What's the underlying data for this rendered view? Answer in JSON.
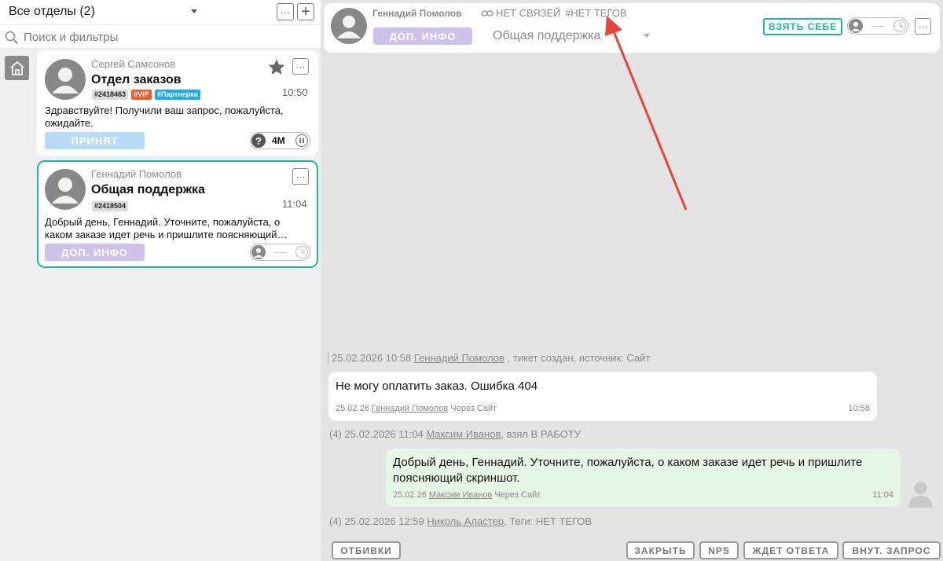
{
  "sidebar": {
    "department_selector": "Все отделы (2)",
    "more_label": "···",
    "add_label": "+",
    "search_placeholder": "Поиск и фильтры"
  },
  "tickets": [
    {
      "client_name": "Сергей Самсонов",
      "department": "Отдел заказов",
      "time": "10:50",
      "tags": [
        "#2418463",
        "#VIP",
        "#Партнерка"
      ],
      "message": "Здравствуйте! Получили ваш запрос, пожалуйста, ожидайте.",
      "status": "ПРИНЯТ",
      "timer": "4М",
      "timer_prefix": "?",
      "more_label": "···",
      "starred": true
    },
    {
      "client_name": "Геннадий Помолов",
      "department": "Общая поддержка",
      "time": "11:04",
      "tags": [
        "#2418504"
      ],
      "message": "Добрый день, Геннадий. Уточните, пожалуйста, о каком заказе идет речь и пришлите поясняющий…",
      "status": "ДОП. ИНФО",
      "more_label": "···",
      "selected": true
    }
  ],
  "header": {
    "client_name": "Геннадий Помолов",
    "links": "НЕТ СВЯЗЕЙ",
    "tags": "#НЕТ ТЕГОВ",
    "info_button": "ДОП. ИНФО",
    "department": "Общая поддержка",
    "take_button": "ВЗЯТЬ СЕБЕ",
    "more_label": "···"
  },
  "feed": {
    "event1": {
      "datetime": "25.02.2026 10:58",
      "user": "Геннадий Помолов",
      "text": ", тикет создан, источник: Сайт"
    },
    "message1": {
      "text": "Не могу оплатить заказ. Ошибка 404",
      "date": "25.02.26",
      "author": "Геннадий Помолов",
      "source": "Через Сайт",
      "time": "10:58"
    },
    "event2": {
      "prefix": "(4) 25.02.2026 11:04",
      "user": "Максим Иванов",
      "text": ", взял В РАБОТУ"
    },
    "message2": {
      "text": "Добрый день, Геннадий. Уточните, пожалуйста, о каком заказе идет речь и пришлите поясняющий скриншот.",
      "date": "25.02.26",
      "author": "Максим Иванов",
      "source": "Через Сайт",
      "time": "11:04"
    },
    "event3": {
      "prefix": "(4) 25.02.2026 12:59",
      "user": "Николь Аластер",
      "text": ", Теги: НЕТ ТЕГОВ"
    }
  },
  "actions": {
    "otbivki": "ОТБИВКИ",
    "close": "ЗАКРЫТЬ",
    "nps": "NPS",
    "wait": "ЖДЕТ ОТВЕТА",
    "internal": "ВНУТ. ЗАПРОС"
  },
  "colors": {
    "accent_teal": "#1fb5a3",
    "vip_tag": "#f15b25",
    "partner_tag": "#1ea9e8",
    "accepted_status": "#b8dcf6",
    "info_status": "#cfc2ea",
    "arrow": "#e5453a"
  },
  "icons": [
    "search-icon",
    "home-icon",
    "star-icon",
    "question-icon",
    "pause-icon",
    "user-icon",
    "clock-icon",
    "link-icon",
    "arrow-annotation"
  ]
}
